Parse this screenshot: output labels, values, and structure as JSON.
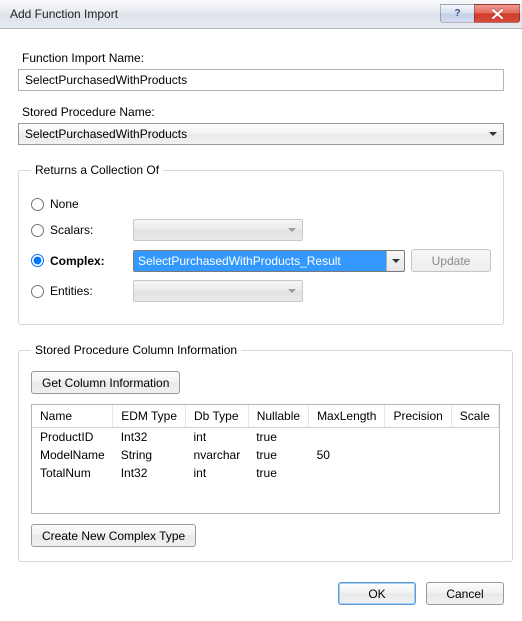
{
  "titlebar": {
    "title": "Add Function Import",
    "help": "?",
    "close": "X"
  },
  "labels": {
    "function_import_name": "Function Import Name:",
    "stored_procedure_name": "Stored Procedure Name:",
    "returns_collection": "Returns a Collection Of",
    "none": "None",
    "scalars": "Scalars:",
    "complex": "Complex:",
    "entities": "Entities:",
    "update": "Update",
    "sp_column_info": "Stored Procedure Column Information",
    "get_column_info": "Get Column Information",
    "create_complex": "Create New Complex Type",
    "ok": "OK",
    "cancel": "Cancel"
  },
  "values": {
    "function_import_name": "SelectPurchasedWithProducts",
    "stored_procedure_name": "SelectPurchasedWithProducts",
    "complex_selected": "SelectPurchasedWithProducts_Result",
    "selected_return": "complex"
  },
  "table": {
    "headers": [
      "Name",
      "EDM Type",
      "Db Type",
      "Nullable",
      "MaxLength",
      "Precision",
      "Scale"
    ],
    "rows": [
      {
        "Name": "ProductID",
        "EDM Type": "Int32",
        "Db Type": "int",
        "Nullable": "true",
        "MaxLength": "",
        "Precision": "",
        "Scale": ""
      },
      {
        "Name": "ModelName",
        "EDM Type": "String",
        "Db Type": "nvarchar",
        "Nullable": "true",
        "MaxLength": "50",
        "Precision": "",
        "Scale": ""
      },
      {
        "Name": "TotalNum",
        "EDM Type": "Int32",
        "Db Type": "int",
        "Nullable": "true",
        "MaxLength": "",
        "Precision": "",
        "Scale": ""
      }
    ]
  }
}
